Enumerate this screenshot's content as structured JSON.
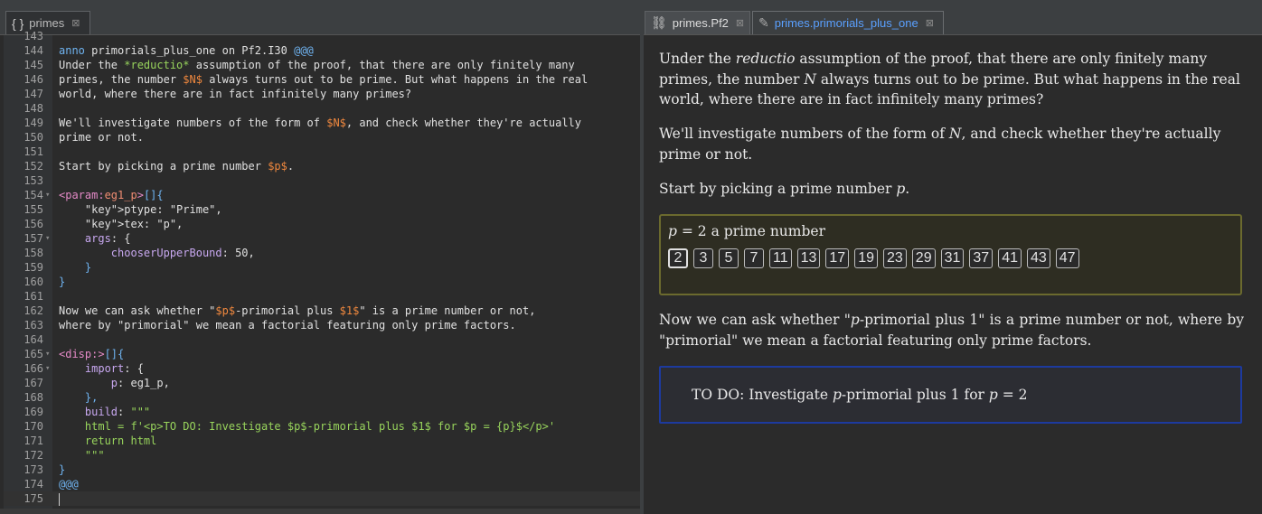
{
  "left_tab": {
    "icon": "{ }",
    "label": "primes",
    "close": "⊠"
  },
  "right_tabs": [
    {
      "icon": "⛓",
      "label": "primes.Pf2",
      "close": "⊠"
    },
    {
      "icon": "✎",
      "label": "primes.primorials_plus_one",
      "close": "⊠"
    }
  ],
  "code_lines": [
    {
      "n": "143",
      "text": ""
    },
    {
      "n": "144",
      "text": "anno primorials_plus_one on Pf2.I30 @@@"
    },
    {
      "n": "145",
      "text": "Under the *reductio* assumption of the proof, that there are only finitely many"
    },
    {
      "n": "146",
      "text": "primes, the number $N$ always turns out to be prime. But what happens in the real"
    },
    {
      "n": "147",
      "text": "world, where there are in fact infinitely many primes?"
    },
    {
      "n": "148",
      "text": ""
    },
    {
      "n": "149",
      "text": "We'll investigate numbers of the form of $N$, and check whether they're actually"
    },
    {
      "n": "150",
      "text": "prime or not."
    },
    {
      "n": "151",
      "text": ""
    },
    {
      "n": "152",
      "text": "Start by picking a prime number $p$."
    },
    {
      "n": "153",
      "text": ""
    },
    {
      "n": "154",
      "text": "<param:eg1_p>[]{"
    },
    {
      "n": "155",
      "text": "    ptype: \"Prime\","
    },
    {
      "n": "156",
      "text": "    tex: \"p\","
    },
    {
      "n": "157",
      "text": "    args: {"
    },
    {
      "n": "158",
      "text": "        chooserUpperBound: 50,"
    },
    {
      "n": "159",
      "text": "    }"
    },
    {
      "n": "160",
      "text": "}"
    },
    {
      "n": "161",
      "text": ""
    },
    {
      "n": "162",
      "text": "Now we can ask whether \"$p$-primorial plus $1$\" is a prime number or not,"
    },
    {
      "n": "163",
      "text": "where by \"primorial\" we mean a factorial featuring only prime factors."
    },
    {
      "n": "164",
      "text": ""
    },
    {
      "n": "165",
      "text": "<disp:>[]{"
    },
    {
      "n": "166",
      "text": "    import: {"
    },
    {
      "n": "167",
      "text": "        p: eg1_p,"
    },
    {
      "n": "168",
      "text": "    },"
    },
    {
      "n": "169",
      "text": "    build: \"\"\""
    },
    {
      "n": "170",
      "text": "    html = f'<p>TO DO: Investigate $p$-primorial plus $1$ for $p = {p}$</p>'"
    },
    {
      "n": "171",
      "text": "    return html"
    },
    {
      "n": "172",
      "text": "    \"\"\""
    },
    {
      "n": "173",
      "text": "}"
    },
    {
      "n": "174",
      "text": "@@@"
    },
    {
      "n": "175",
      "text": ""
    }
  ],
  "render": {
    "p1_a": "Under the ",
    "p1_em": "reductio",
    "p1_b": " assumption of the proof, that there are only finitely many primes, the number ",
    "p1_var": "N",
    "p1_c": " always turns out to be prime. But what happens in the real world, where there are in fact infinitely many primes?",
    "p2_a": "We'll investigate numbers of the form of ",
    "p2_var": "N",
    "p2_b": ", and check whether they're actually prime or not.",
    "p3_a": "Start by picking a prime number ",
    "p3_var": "p",
    "p3_b": ".",
    "widget_var": "p",
    "widget_eq": " = 2",
    "widget_text": " a prime number",
    "primes": [
      "2",
      "3",
      "5",
      "7",
      "11",
      "13",
      "17",
      "19",
      "23",
      "29",
      "31",
      "37",
      "41",
      "43",
      "47"
    ],
    "selected_prime": "2",
    "p4_a": "Now we can ask whether \"",
    "p4_var": "p",
    "p4_b": "-primorial plus 1\" is a prime number or not, where by \"primorial\" we mean a factorial featuring only prime factors.",
    "disp_a": "TO DO: Investigate ",
    "disp_var": "p",
    "disp_b": "-primorial plus 1 for ",
    "disp_var2": "p",
    "disp_c": " = 2"
  },
  "colors": {
    "widget_border": "#6b6a2e",
    "disp_border": "#1d3a9e",
    "active_tab": "#5aa0ff"
  }
}
